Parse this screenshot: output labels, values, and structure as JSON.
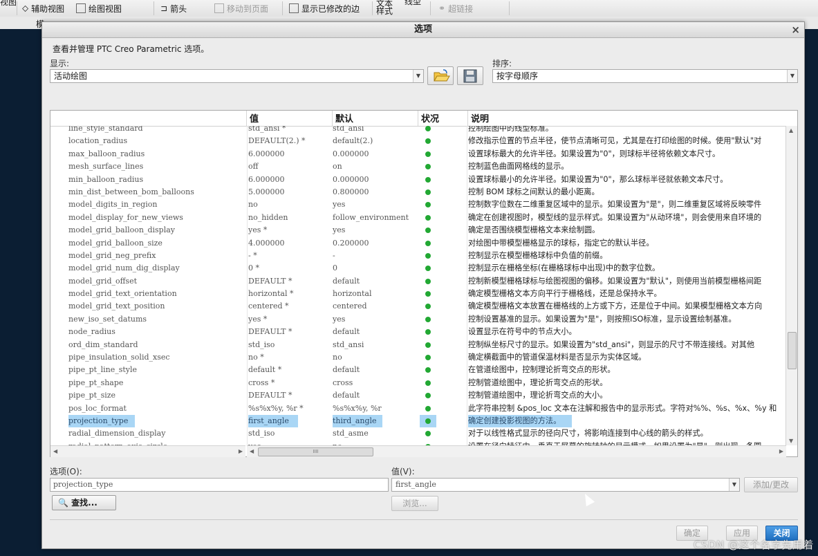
{
  "toolbar": {
    "items": [
      {
        "label": "视图",
        "enabled": true
      },
      {
        "label": "辅助视图",
        "enabled": true
      },
      {
        "label": "绘图视图",
        "enabled": true
      },
      {
        "label": "箭头",
        "enabled": true
      },
      {
        "label": "移动到页面",
        "enabled": false
      },
      {
        "label": "显示已修改的边",
        "enabled": true
      },
      {
        "label": "文本样式",
        "enabled": true
      },
      {
        "label": "线型",
        "enabled": true
      },
      {
        "label": "超链接",
        "enabled": false
      }
    ],
    "strip_label": "模"
  },
  "dialog": {
    "title": "选项",
    "close_label": "×",
    "description": "查看并管理 PTC Creo Parametric 选项。",
    "display_label": "显示:",
    "display_value": "活动绘图",
    "sort_label": "排序:",
    "sort_value": "按字母顺序"
  },
  "table": {
    "columns": [
      "",
      "值",
      "默认",
      "状况",
      "说明"
    ],
    "rows": [
      {
        "name": "line_style_standard",
        "value": "std_ansi *",
        "default": "std_ansi",
        "desc": "控制绘图中的线型标准。",
        "selected": false
      },
      {
        "name": "location_radius",
        "value": "DEFAULT(2.) *",
        "default": "default(2.)",
        "desc": "修改指示位置的节点半径，使节点清晰可见，尤其是在打印绘图的时候。使用\"默认\"对",
        "selected": false
      },
      {
        "name": "max_balloon_radius",
        "value": "6.000000",
        "default": "0.000000",
        "desc": "设置球标最大的允许半径。如果设置为\"0\"，则球标半径将依赖文本尺寸。",
        "selected": false
      },
      {
        "name": "mesh_surface_lines",
        "value": "off",
        "default": "on",
        "desc": "控制蓝色曲面网格线的显示。",
        "selected": false
      },
      {
        "name": "min_balloon_radius",
        "value": "6.000000",
        "default": "0.000000",
        "desc": "设置球标最小的允许半径。如果设置为\"0\"，那么球标半径就依赖文本尺寸。",
        "selected": false
      },
      {
        "name": "min_dist_between_bom_balloons",
        "value": "5.000000",
        "default": "0.800000",
        "desc": "控制 BOM 球标之间默认的最小距离。",
        "selected": false
      },
      {
        "name": "model_digits_in_region",
        "value": "no",
        "default": "yes",
        "desc": "控制数字位数在二维重复区域中的显示。如果设置为\"是\"，则二维重复区域将反映零件",
        "selected": false
      },
      {
        "name": "model_display_for_new_views",
        "value": "no_hidden",
        "default": "follow_environment",
        "desc": "确定在创建视图时，模型线的显示样式。如果设置为\"从动环境\"，则会使用来自环境的",
        "selected": false
      },
      {
        "name": "model_grid_balloon_display",
        "value": "yes *",
        "default": "yes",
        "desc": "确定是否围绕模型栅格文本来绘制圆。",
        "selected": false
      },
      {
        "name": "model_grid_balloon_size",
        "value": "4.000000",
        "default": "0.200000",
        "desc": "对绘图中带模型栅格显示的球标，指定它的默认半径。",
        "selected": false
      },
      {
        "name": "model_grid_neg_prefix",
        "value": "- *",
        "default": "-",
        "desc": "控制显示在模型栅格球标中负值的前缀。",
        "selected": false
      },
      {
        "name": "model_grid_num_dig_display",
        "value": "0 *",
        "default": "0",
        "desc": "控制显示在栅格坐标(在栅格球标中出现)中的数字位数。",
        "selected": false
      },
      {
        "name": "model_grid_offset",
        "value": "DEFAULT *",
        "default": "default",
        "desc": "控制新模型栅格球标与绘图视图的偏移。如果设置为\"默认\"，则使用当前模型栅格间距",
        "selected": false
      },
      {
        "name": "model_grid_text_orientation",
        "value": "horizontal *",
        "default": "horizontal",
        "desc": "确定模型栅格文本方向平行于栅格线，还是总保持水平。",
        "selected": false
      },
      {
        "name": "model_grid_text_position",
        "value": "centered *",
        "default": "centered",
        "desc": "确定模型栅格文本放置在栅格线的上方或下方，还是位于中间。如果模型栅格文本方向",
        "selected": false
      },
      {
        "name": "new_iso_set_datums",
        "value": "yes *",
        "default": "yes",
        "desc": "控制设置基准的显示。如果设置为\"是\"，则按照ISO标准，显示设置绘制基准。",
        "selected": false
      },
      {
        "name": "node_radius",
        "value": "DEFAULT *",
        "default": "default",
        "desc": "设置显示在符号中的节点大小。",
        "selected": false
      },
      {
        "name": "ord_dim_standard",
        "value": "std_iso",
        "default": "std_ansi",
        "desc": "控制纵坐标尺寸的显示。如果设置为\"std_ansi\"，则显示的尺寸不带连接线。对其他",
        "selected": false
      },
      {
        "name": "pipe_insulation_solid_xsec",
        "value": "no *",
        "default": "no",
        "desc": "确定横截面中的管道保温材料是否显示为实体区域。",
        "selected": false
      },
      {
        "name": "pipe_pt_line_style",
        "value": "default *",
        "default": "default",
        "desc": "在管道绘图中，控制理论折弯交点的形状。",
        "selected": false
      },
      {
        "name": "pipe_pt_shape",
        "value": "cross *",
        "default": "cross",
        "desc": "控制管道绘图中，理论折弯交点的形状。",
        "selected": false
      },
      {
        "name": "pipe_pt_size",
        "value": "DEFAULT *",
        "default": "default",
        "desc": "控制管道绘图中，理论折弯交点的大小。",
        "selected": false
      },
      {
        "name": "pos_loc_format",
        "value": "%s%x%y, %r *",
        "default": "%s%x%y, %r",
        "desc": "此字符串控制 &pos_loc 文本在注解和报告中的显示形式。字符对%%、%s、%x、%y 和",
        "selected": false
      },
      {
        "name": "projection_type",
        "value": "first_angle",
        "default": "third_angle",
        "desc": "确定创建投影视图的方法。",
        "selected": true
      },
      {
        "name": "radial_dimension_display",
        "value": "std_iso",
        "default": "std_asme",
        "desc": "对于以线性格式显示的径向尺寸，将影响连接到中心线的箭头的样式。",
        "selected": false
      },
      {
        "name": "radial_pattern_axis_circle",
        "value": "yes",
        "default": "no",
        "desc": "设置在径向特征中，垂直于屏幕的旋转轴的显示模式。如果设置为\"是\"，则出现一条圆",
        "selected": false
      }
    ],
    "hscroll_grip": "IIII"
  },
  "bottom": {
    "option_label": "选项(O):",
    "option_value": "projection_type",
    "value_label": "值(V):",
    "value_value": "first_angle",
    "add_change": "添加/更改",
    "find": "查找...",
    "browse": "浏览...",
    "ok": "确定",
    "apply": "应用",
    "close": "关闭"
  },
  "watermark": "CSDN @这个名字先用着",
  "colors": {
    "status_dot": "#22a833",
    "selection": "#a9d6f5",
    "primary_button": "#1f6fc0"
  }
}
